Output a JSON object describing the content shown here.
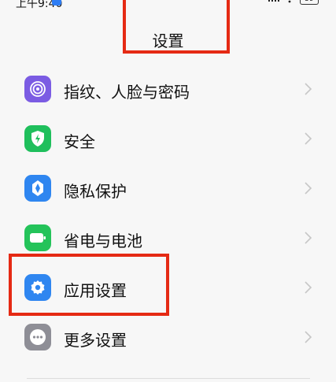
{
  "status_bar": {
    "time": "上午9:40",
    "battery": "59"
  },
  "header": {
    "title": "设置"
  },
  "settings": [
    {
      "label": "指纹、人脸与密码",
      "icon": "fingerprint-icon",
      "color": "#7b5ce3"
    },
    {
      "label": "安全",
      "icon": "shield-icon",
      "color": "#1fbf5c"
    },
    {
      "label": "隐私保护",
      "icon": "privacy-icon",
      "color": "#2f86f0"
    },
    {
      "label": "省电与电池",
      "icon": "battery-saver-icon",
      "color": "#24c35a"
    },
    {
      "label": "应用设置",
      "icon": "gear-icon",
      "color": "#2f86f0"
    },
    {
      "label": "更多设置",
      "icon": "more-icon",
      "color": "#8e8e96"
    }
  ],
  "annotations": {
    "color": "#e52a14"
  }
}
